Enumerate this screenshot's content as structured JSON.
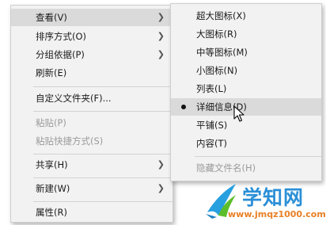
{
  "context_menu": {
    "items": [
      {
        "label": "查看(V)"
      },
      {
        "label": "排序方式(O)"
      },
      {
        "label": "分组依据(P)"
      },
      {
        "label": "刷新(E)"
      },
      {
        "label": "自定义文件夹(F)..."
      },
      {
        "label": "粘贴(P)"
      },
      {
        "label": "粘贴快捷方式(S)"
      },
      {
        "label": "共享(H)"
      },
      {
        "label": "新建(W)"
      },
      {
        "label": "属性(R)"
      }
    ]
  },
  "view_submenu": {
    "items": [
      {
        "label": "超大图标(X)"
      },
      {
        "label": "大图标(R)"
      },
      {
        "label": "中等图标(M)"
      },
      {
        "label": "小图标(N)"
      },
      {
        "label": "列表(L)"
      },
      {
        "label": "详细信息(D)",
        "selected": true
      },
      {
        "label": "平铺(S)"
      },
      {
        "label": "内容(T)"
      },
      {
        "label": "隐藏文件名(H)"
      }
    ]
  },
  "watermark": {
    "title": "学知网",
    "url": "www.jmqz1000.com"
  },
  "colors": {
    "menu_bg": "#f2f2f2",
    "hover_bg": "#dadada",
    "disabled_text": "#9b9b9b",
    "watermark_blue": "#2b8fd6",
    "watermark_orange": "#e88024"
  }
}
